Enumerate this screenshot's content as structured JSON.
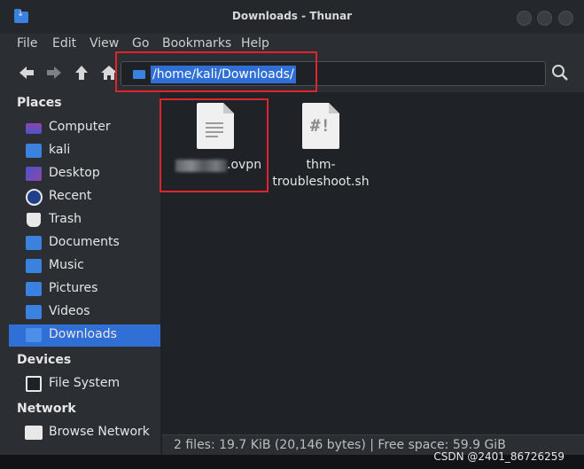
{
  "window": {
    "title": "Downloads - Thunar"
  },
  "menu": [
    "File",
    "Edit",
    "View",
    "Go",
    "Bookmarks",
    "Help"
  ],
  "toolbar": {
    "location": "/home/kali/Downloads/"
  },
  "sidebar": {
    "places_title": "Places",
    "places": [
      {
        "label": "Computer",
        "icon": "computer-icon",
        "color": "#8e44ad"
      },
      {
        "label": "kali",
        "icon": "home-folder-icon",
        "color": "#3b82e0"
      },
      {
        "label": "Desktop",
        "icon": "desktop-icon",
        "color": "#6a3fc2"
      },
      {
        "label": "Recent",
        "icon": "recent-icon",
        "color": "#3b82e0"
      },
      {
        "label": "Trash",
        "icon": "trash-icon",
        "color": "#e8e8e8"
      },
      {
        "label": "Documents",
        "icon": "documents-folder-icon",
        "color": "#3b82e0"
      },
      {
        "label": "Music",
        "icon": "music-folder-icon",
        "color": "#3b82e0"
      },
      {
        "label": "Pictures",
        "icon": "pictures-folder-icon",
        "color": "#3b82e0"
      },
      {
        "label": "Videos",
        "icon": "videos-folder-icon",
        "color": "#3b82e0"
      },
      {
        "label": "Downloads",
        "icon": "downloads-folder-icon",
        "color": "#3b82e0",
        "active": true
      }
    ],
    "devices_title": "Devices",
    "devices": [
      {
        "label": "File System",
        "icon": "drive-icon"
      }
    ],
    "network_title": "Network",
    "network": [
      {
        "label": "Browse Network",
        "icon": "network-icon"
      }
    ]
  },
  "files": [
    {
      "name": ".ovpn",
      "icon": "text-file-icon"
    },
    {
      "name_line1": "thm-",
      "name_line2": "troubleshoot.sh",
      "icon": "script-file-icon"
    }
  ],
  "status": "2 files: 19.7 KiB (20,146 bytes)  |  Free space: 59.9 GiB",
  "watermark": "CSDN @2401_86726259",
  "colors": {
    "accent": "#2f6fd6",
    "highlight_box": "#e0242d"
  }
}
